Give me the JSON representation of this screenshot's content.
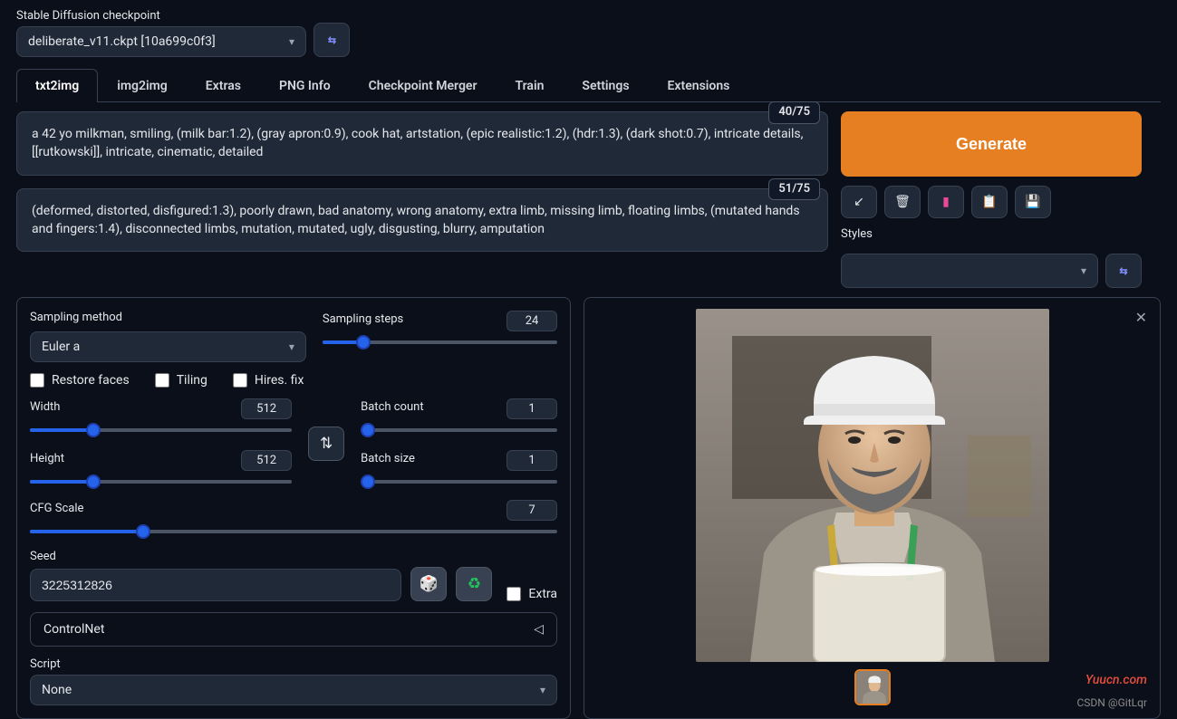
{
  "checkpoint": {
    "label": "Stable Diffusion checkpoint",
    "value": "deliberate_v11.ckpt [10a699c0f3]",
    "reload_icon": "🔄"
  },
  "tabs": [
    "txt2img",
    "img2img",
    "Extras",
    "PNG Info",
    "Checkpoint Merger",
    "Train",
    "Settings",
    "Extensions"
  ],
  "active_tab": "txt2img",
  "prompt": {
    "tokens": "40/75",
    "text": "a 42 yo milkman, smiling, (milk bar:1.2), (gray apron:0.9), cook hat, artstation, (epic realistic:1.2), (hdr:1.3), (dark shot:0.7), intricate details, [[rutkowski]], intricate, cinematic, detailed"
  },
  "neg_prompt": {
    "tokens": "51/75",
    "text": "(deformed, distorted, disfigured:1.3), poorly drawn, bad anatomy, wrong anatomy, extra limb, missing limb, floating limbs, (mutated hands and fingers:1.4), disconnected limbs, mutation, mutated, ugly, disgusting, blurry, amputation"
  },
  "generate_label": "Generate",
  "styles": {
    "label": "Styles",
    "value": ""
  },
  "sampling": {
    "method_label": "Sampling method",
    "method_value": "Euler a",
    "steps_label": "Sampling steps",
    "steps_value": "24",
    "steps_pct": 16
  },
  "checks": {
    "restore": "Restore faces",
    "tiling": "Tiling",
    "hires": "Hires. fix"
  },
  "dims": {
    "width_label": "Width",
    "width_value": "512",
    "width_pct": 24,
    "height_label": "Height",
    "height_value": "512",
    "height_pct": 24
  },
  "batch": {
    "count_label": "Batch count",
    "count_value": "1",
    "count_pct": 0,
    "size_label": "Batch size",
    "size_value": "1",
    "size_pct": 0
  },
  "cfg": {
    "label": "CFG Scale",
    "value": "7",
    "pct": 22
  },
  "seed": {
    "label": "Seed",
    "value": "3225312826",
    "extra_label": "Extra"
  },
  "controlnet": {
    "label": "ControlNet"
  },
  "script": {
    "label": "Script",
    "value": "None"
  },
  "watermarks": {
    "a": "Yuucn.com",
    "b": "CSDN @GitLqr"
  }
}
